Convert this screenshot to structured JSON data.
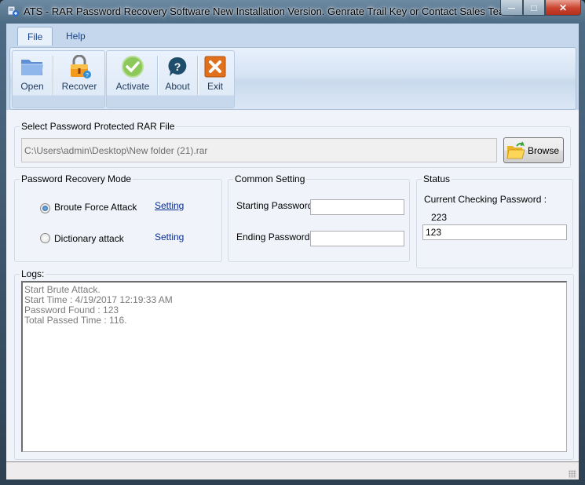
{
  "window": {
    "title": "ATS - RAR Password Recovery Software New Installation Version. Genrate Trail Key or Contact Sales Team",
    "icon": "app-icon",
    "controls": {
      "minimize": "—",
      "maximize": "□",
      "close": "✕"
    }
  },
  "ribbon": {
    "tabs": [
      {
        "label": "File",
        "active": true
      },
      {
        "label": "Help",
        "active": false
      }
    ],
    "groups": [
      {
        "buttons": [
          {
            "label": "Open",
            "icon": "folder-open-icon"
          },
          {
            "label": "Recover",
            "icon": "padlock-icon"
          }
        ]
      },
      {
        "buttons": [
          {
            "label": "Activate",
            "icon": "checkmark-icon"
          },
          {
            "label": "About",
            "icon": "help-icon"
          },
          {
            "label": "Exit",
            "icon": "exit-x-icon"
          }
        ]
      }
    ]
  },
  "file_section": {
    "legend": "Select Password Protected RAR File",
    "path_value": "C:\\Users\\admin\\Desktop\\New folder (21).rar",
    "browse_label": "Browse",
    "browse_icon": "folder-icon"
  },
  "recovery_mode": {
    "legend": "Password Recovery Mode",
    "options": [
      {
        "label": "Broute Force Attack",
        "selected": true,
        "setting_label": "Setting"
      },
      {
        "label": "Dictionary attack",
        "selected": false,
        "setting_label": "Setting"
      }
    ]
  },
  "common_setting": {
    "legend": "Common Setting",
    "starting_label": "Starting Password :",
    "starting_value": "",
    "ending_label": "Ending Password :",
    "ending_value": ""
  },
  "status": {
    "legend": "Status",
    "current_label": "Current Checking Password :",
    "current_value": "223",
    "found_value": "123"
  },
  "logs": {
    "legend": "Logs:",
    "lines": [
      "Start Brute Attack.",
      "Start Time : 4/19/2017 12:19:33 AM",
      "Password Found : 123",
      "Total Passed Time : 116."
    ]
  },
  "colors": {
    "ribbon_text": "#1e395b",
    "tab_text": "#15428b",
    "link": "#0a2d8f",
    "close_button": "#c9422d"
  }
}
